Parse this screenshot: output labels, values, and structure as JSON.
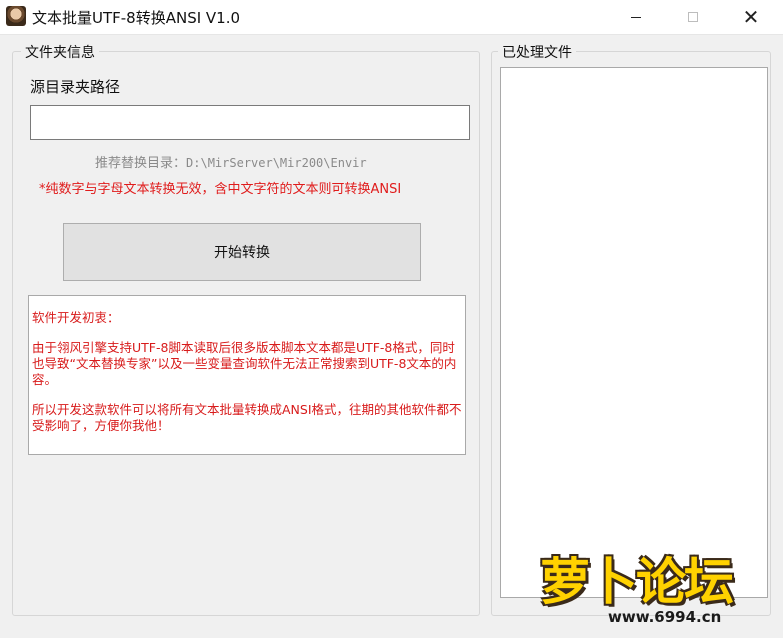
{
  "window": {
    "title": "文本批量UTF-8转换ANSI  V1.0",
    "minimize_symbol": "",
    "close_symbol": "✕"
  },
  "left_panel": {
    "group_label": "文件夹信息",
    "source_label": "源目录夹路径",
    "path_value": "",
    "hint_label": "推荐替换目录：",
    "hint_path": "D:\\MirServer\\Mir200\\Envir",
    "warning": "*纯数字与字母文本转换无效，含中文字符的文本则可转换ANSI",
    "start_button": "开始转换",
    "notes": {
      "heading": "软件开发初衷：",
      "para1": "由于翎风引擎支持UTF-8脚本读取后很多版本脚本文本都是UTF-8格式，同时也导致“文本替换专家”以及一些变量查询软件无法正常搜索到UTF-8文本的内容。",
      "para2": "所以开发这款软件可以将所有文本批量转换成ANSI格式，往期的其他软件都不受影响了，方便你我他！"
    }
  },
  "right_panel": {
    "group_label": "已处理文件",
    "files": []
  },
  "watermark": {
    "title": "萝卜论坛",
    "url": "www.6994.cn"
  },
  "colors": {
    "warning_red": "#e01b1b",
    "hint_gray": "#8a8a8a",
    "window_bg": "#f0f0f0"
  }
}
